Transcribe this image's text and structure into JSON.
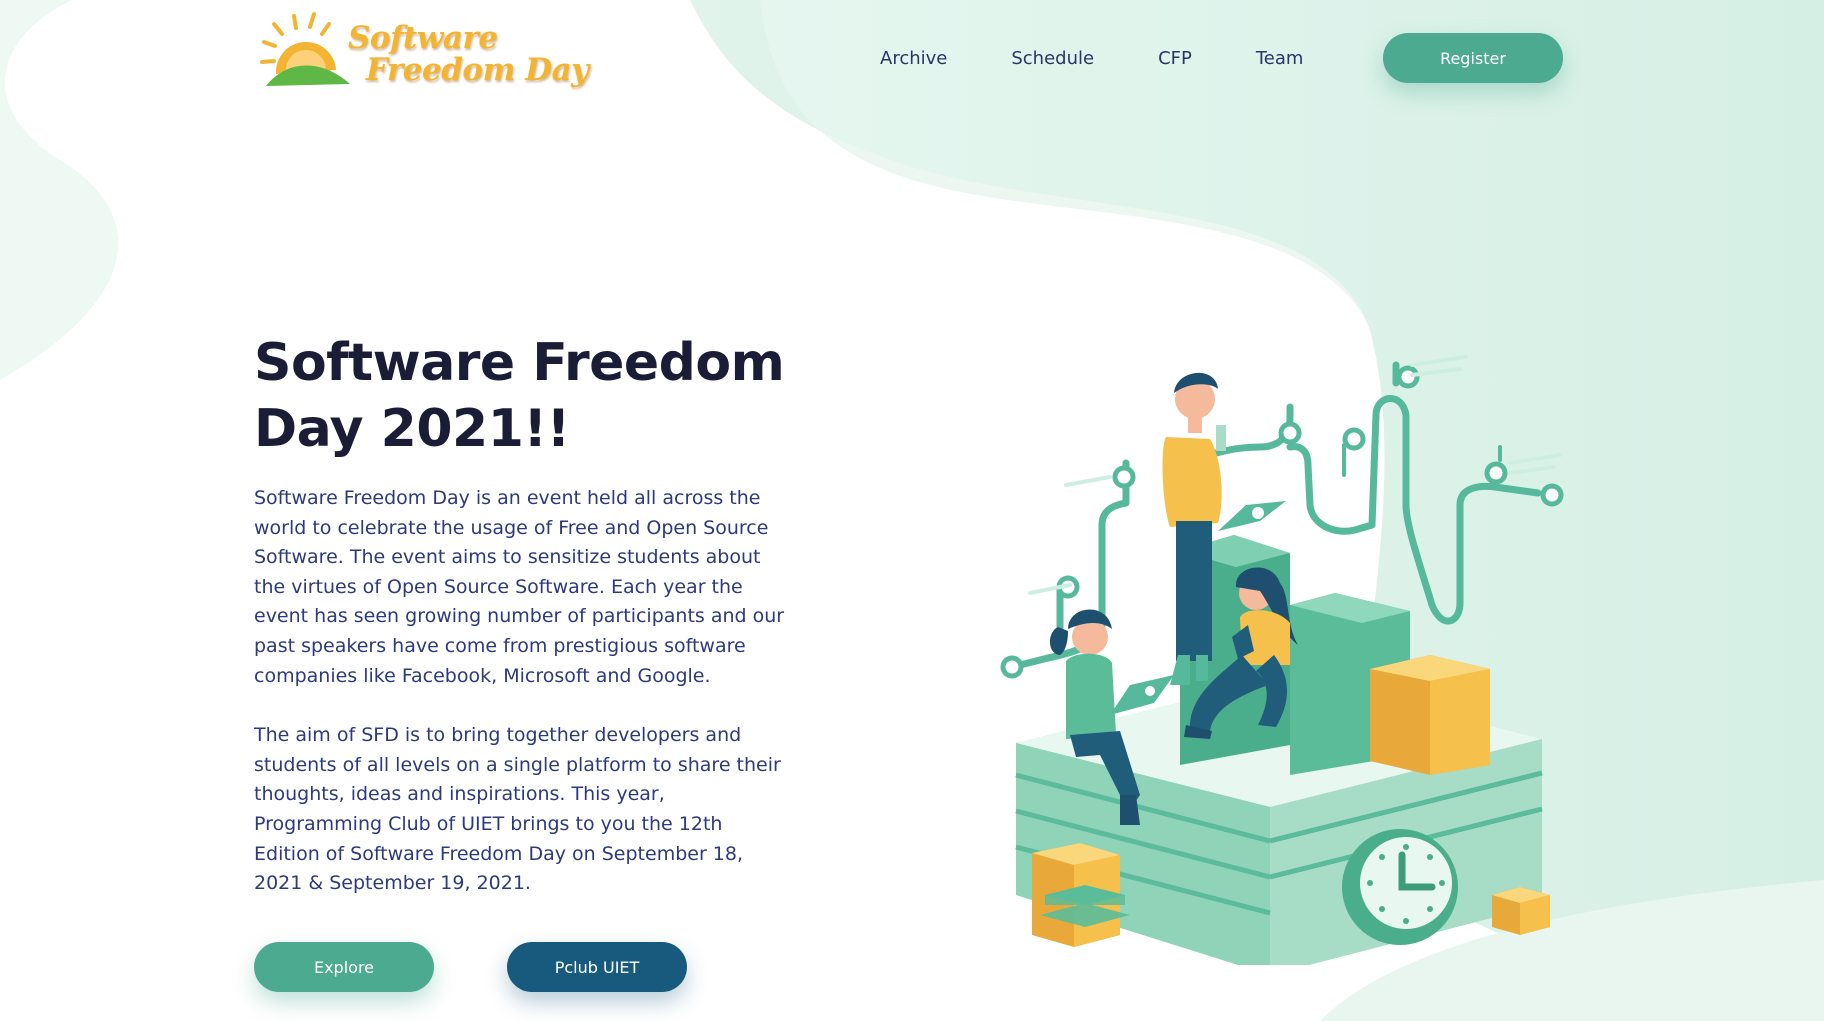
{
  "brand": {
    "line1": "Software",
    "line2": "Freedom Day",
    "text_color": "#f4b433",
    "sun_color": "#f4b433",
    "hill_color": "#5fb846"
  },
  "nav": {
    "items": [
      {
        "label": "Archive"
      },
      {
        "label": "Schedule"
      },
      {
        "label": "CFP"
      },
      {
        "label": "Team"
      }
    ],
    "register_label": "Register"
  },
  "hero": {
    "title_line1": "Software Freedom",
    "title_line2": "Day 2021!!",
    "paragraph1": "Software Freedom Day is an event held all across the world to celebrate the usage of Free and Open Source Software. The event aims to sensitize students about the virtues of Open Source Software. Each year the event has seen growing number of participants and our past speakers have come from prestigious software companies like Facebook, Microsoft and Google.",
    "paragraph2": "The aim of SFD is to bring together developers and students of all levels on a single platform to share their thoughts, ideas and inspirations. This year, Programming Club of UIET brings to you the 12th Edition of Software Freedom Day on September 18, 2021 & September 19, 2021.",
    "explore_label": "Explore",
    "pclub_label": "Pclub UIET"
  },
  "colors": {
    "primary": "#4baa8f",
    "secondary": "#175a7d",
    "title": "#1b1d36",
    "body_text": "#2d3a7a",
    "background_wave": "#e3f5ee",
    "accent_yellow": "#f6c04d"
  },
  "icons": {
    "logo": "sun-over-hill-logo",
    "illustration": "team-working-isometric-illustration",
    "clock": "clock-icon"
  }
}
